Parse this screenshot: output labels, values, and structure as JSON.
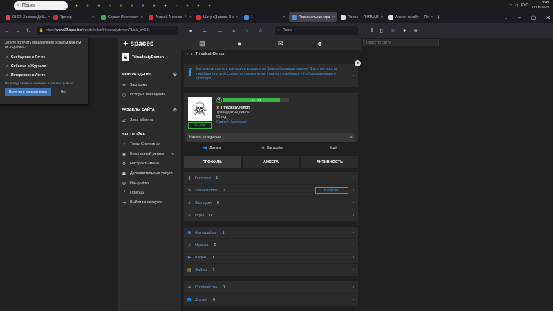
{
  "taskbar": {
    "search_placeholder": "Поиск",
    "tray_lang": "РУС",
    "time": "9:48",
    "date": "22.08.2023",
    "icons": [
      "explorer-icon",
      "chrome-icon",
      "telegram-icon",
      "store-icon",
      "app1-icon",
      "app2-icon",
      "app3-icon",
      "app4-icon",
      "app5-icon",
      "photoshop-icon",
      "app6-icon",
      "app7-icon",
      "firefox-icon"
    ]
  },
  "browser": {
    "tabs": [
      {
        "label": "01.07. Хроника Дебь",
        "color": "#e04040"
      },
      {
        "label": "Тренер",
        "color": "#cc3333"
      },
      {
        "label": "Сериал Инопланет",
        "color": "#39b54a"
      },
      {
        "label": "Андрей Антонов - Ч",
        "color": "#e03030"
      },
      {
        "label": "Шатун (1 книга- 3 к",
        "color": "#e03030"
      },
      {
        "label": "1",
        "color": "#4a90e2"
      },
      {
        "label": "Персональная стра",
        "color": "#5b8fd0",
        "active": true
      },
      {
        "label": "Посты — ПИПМАЙ",
        "color": "#dddddd"
      },
      {
        "label": "Аналог пикабу — По",
        "color": "#dddddd"
      }
    ],
    "url_prefix": "https://",
    "url_host": "world22.spcs.bio",
    "url_path": "/mysite/index/trinadcatydemon/?Link_id=141",
    "nav_search_placeholder": "Поиск"
  },
  "notification": {
    "question": "Хотите получать уведомления о самом важном от «Spaces»?",
    "options": [
      "Сообщения в Почте",
      "События в Журнале",
      "Интересное в Ленте"
    ],
    "hint_prefix": "Вы всегда сможете изменить это в ",
    "hint_link": "Настройках",
    "enable_label": "Включить уведомления",
    "no_label": "Нет"
  },
  "site": {
    "logo": "spaces",
    "search_placeholder": "Поиск по сайту",
    "sidebar": {
      "username": "TrinadcatyDemon",
      "my_sections_title": "МОИ РАЗДЕЛЫ",
      "my_sections": [
        {
          "icon": "bookmark-icon",
          "glyph": "★",
          "label": "Закладки"
        },
        {
          "icon": "history-icon",
          "glyph": "◷",
          "label": "История посещений"
        }
      ],
      "site_sections_title": "РАЗДЕЛЫ САЙТА",
      "site_sections": [
        {
          "icon": "exchange-icon",
          "glyph": "⇄",
          "label": "Зона обмена"
        }
      ],
      "settings_title": "НАСТРОЙКА",
      "settings": [
        {
          "icon": "theme-icon",
          "glyph": "◑",
          "label": "Тема: Системная"
        },
        {
          "icon": "safe-mode-icon",
          "glyph": "◉",
          "label": "Безопасный режим"
        },
        {
          "icon": "menu-settings-icon",
          "glyph": "⚙",
          "label": "Настроить меню"
        },
        {
          "icon": "services-icon",
          "glyph": "☗",
          "label": "Дополнительные услуги"
        },
        {
          "icon": "settings-icon",
          "glyph": "⚙",
          "label": "Настройки"
        },
        {
          "icon": "help-icon",
          "glyph": "?",
          "label": "Помощь"
        },
        {
          "icon": "logout-icon",
          "glyph": "⇥",
          "label": "Выйти из аккаунта"
        }
      ]
    },
    "breadcrumb": "TrinadcatyDemon",
    "tip": "Вы можете сделать закладку и заходить на Spaces без ввода пароля. Для этого просто перейдите по этой ссылке на специальную страницу и добавьте её в Закладки вашего браузера.",
    "profile": {
      "level": "4",
      "xp_text": "64 / 74",
      "xp_fraction": 0.86,
      "name": "TrinadcatyDemon",
      "fullname": "Тринадцатый Демон",
      "age": "61 год",
      "city": "Сидней, Австралия",
      "online": "В сети",
      "status_text": "Никому не здрасьте."
    },
    "actions": [
      {
        "icon": "friends-icon",
        "glyph": "👥",
        "label": "Друзья"
      },
      {
        "icon": "gear-icon",
        "glyph": "⚙",
        "label": "Настройки"
      },
      {
        "icon": "more-icon",
        "glyph": "⋮",
        "label": "Ещё"
      }
    ],
    "profile_tabs": [
      "ПРОФИЛЬ",
      "АНКЕТА",
      "АКТИВНОСТЬ"
    ],
    "write_label": "Написать",
    "sections": [
      {
        "icon": "guestbook-icon",
        "glyph": "▮",
        "color": "#a070e0",
        "label": "Гостевая",
        "count": "0"
      },
      {
        "icon": "blog-icon",
        "glyph": "✎",
        "color": "#e0b040",
        "label": "Личный блог",
        "count": "0",
        "write": true
      },
      {
        "icon": "bookmarks-icon",
        "glyph": "★",
        "color": "#4a90e2",
        "label": "Закладки",
        "count": "0"
      },
      {
        "icon": "games-icon",
        "glyph": "✕",
        "color": "#4a90e2",
        "label": "Игры",
        "count": "0"
      },
      {
        "icon": "photos-icon",
        "glyph": "▣",
        "color": "#4a90e2",
        "label": "Фотографии",
        "count": "1",
        "gap": true
      },
      {
        "icon": "music-icon",
        "glyph": "♫",
        "color": "#a070e0",
        "label": "Музыка",
        "count": "0"
      },
      {
        "icon": "video-icon",
        "glyph": "▶",
        "color": "#4a90e2",
        "label": "Видео",
        "count": "0"
      },
      {
        "icon": "files-icon",
        "glyph": "▤",
        "color": "#e0c040",
        "label": "Файлы",
        "count": "1"
      },
      {
        "icon": "communities-icon",
        "glyph": "♣",
        "color": "#39b54a",
        "label": "Сообщества",
        "count": "0",
        "gap": true
      },
      {
        "icon": "friends-list-icon",
        "glyph": "👥",
        "color": "#39b54a",
        "label": "Друзья",
        "count": "0"
      }
    ]
  }
}
